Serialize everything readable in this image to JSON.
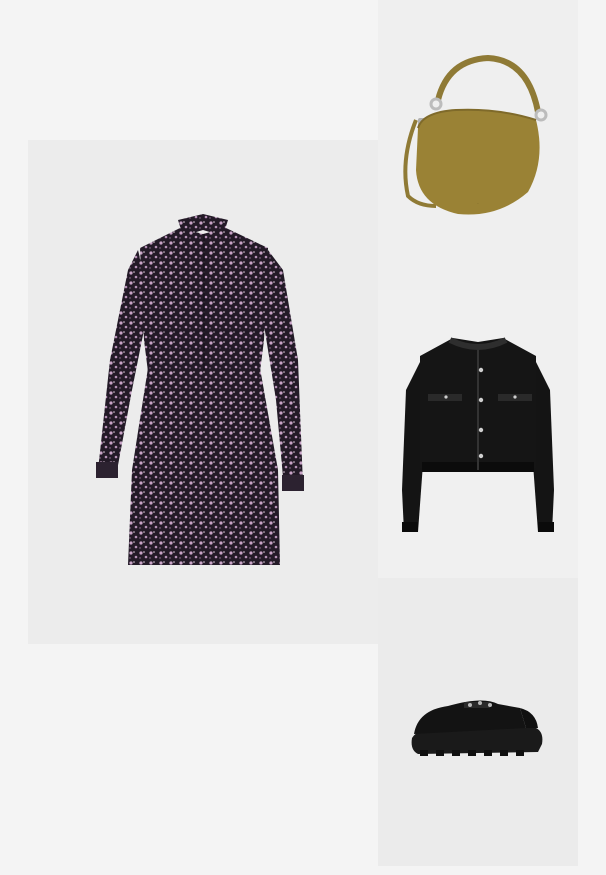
{
  "outfit": {
    "items": [
      {
        "id": "dress",
        "icon": "floral-shirt-dress-image",
        "color": "#2a1f2e"
      },
      {
        "id": "bag",
        "icon": "suede-hobo-bag-image",
        "color": "#9a8235"
      },
      {
        "id": "jacket",
        "icon": "cropped-tweed-jacket-image",
        "color": "#141414"
      },
      {
        "id": "shoe",
        "icon": "chunky-mule-loafer-image",
        "color": "#161616"
      }
    ]
  }
}
